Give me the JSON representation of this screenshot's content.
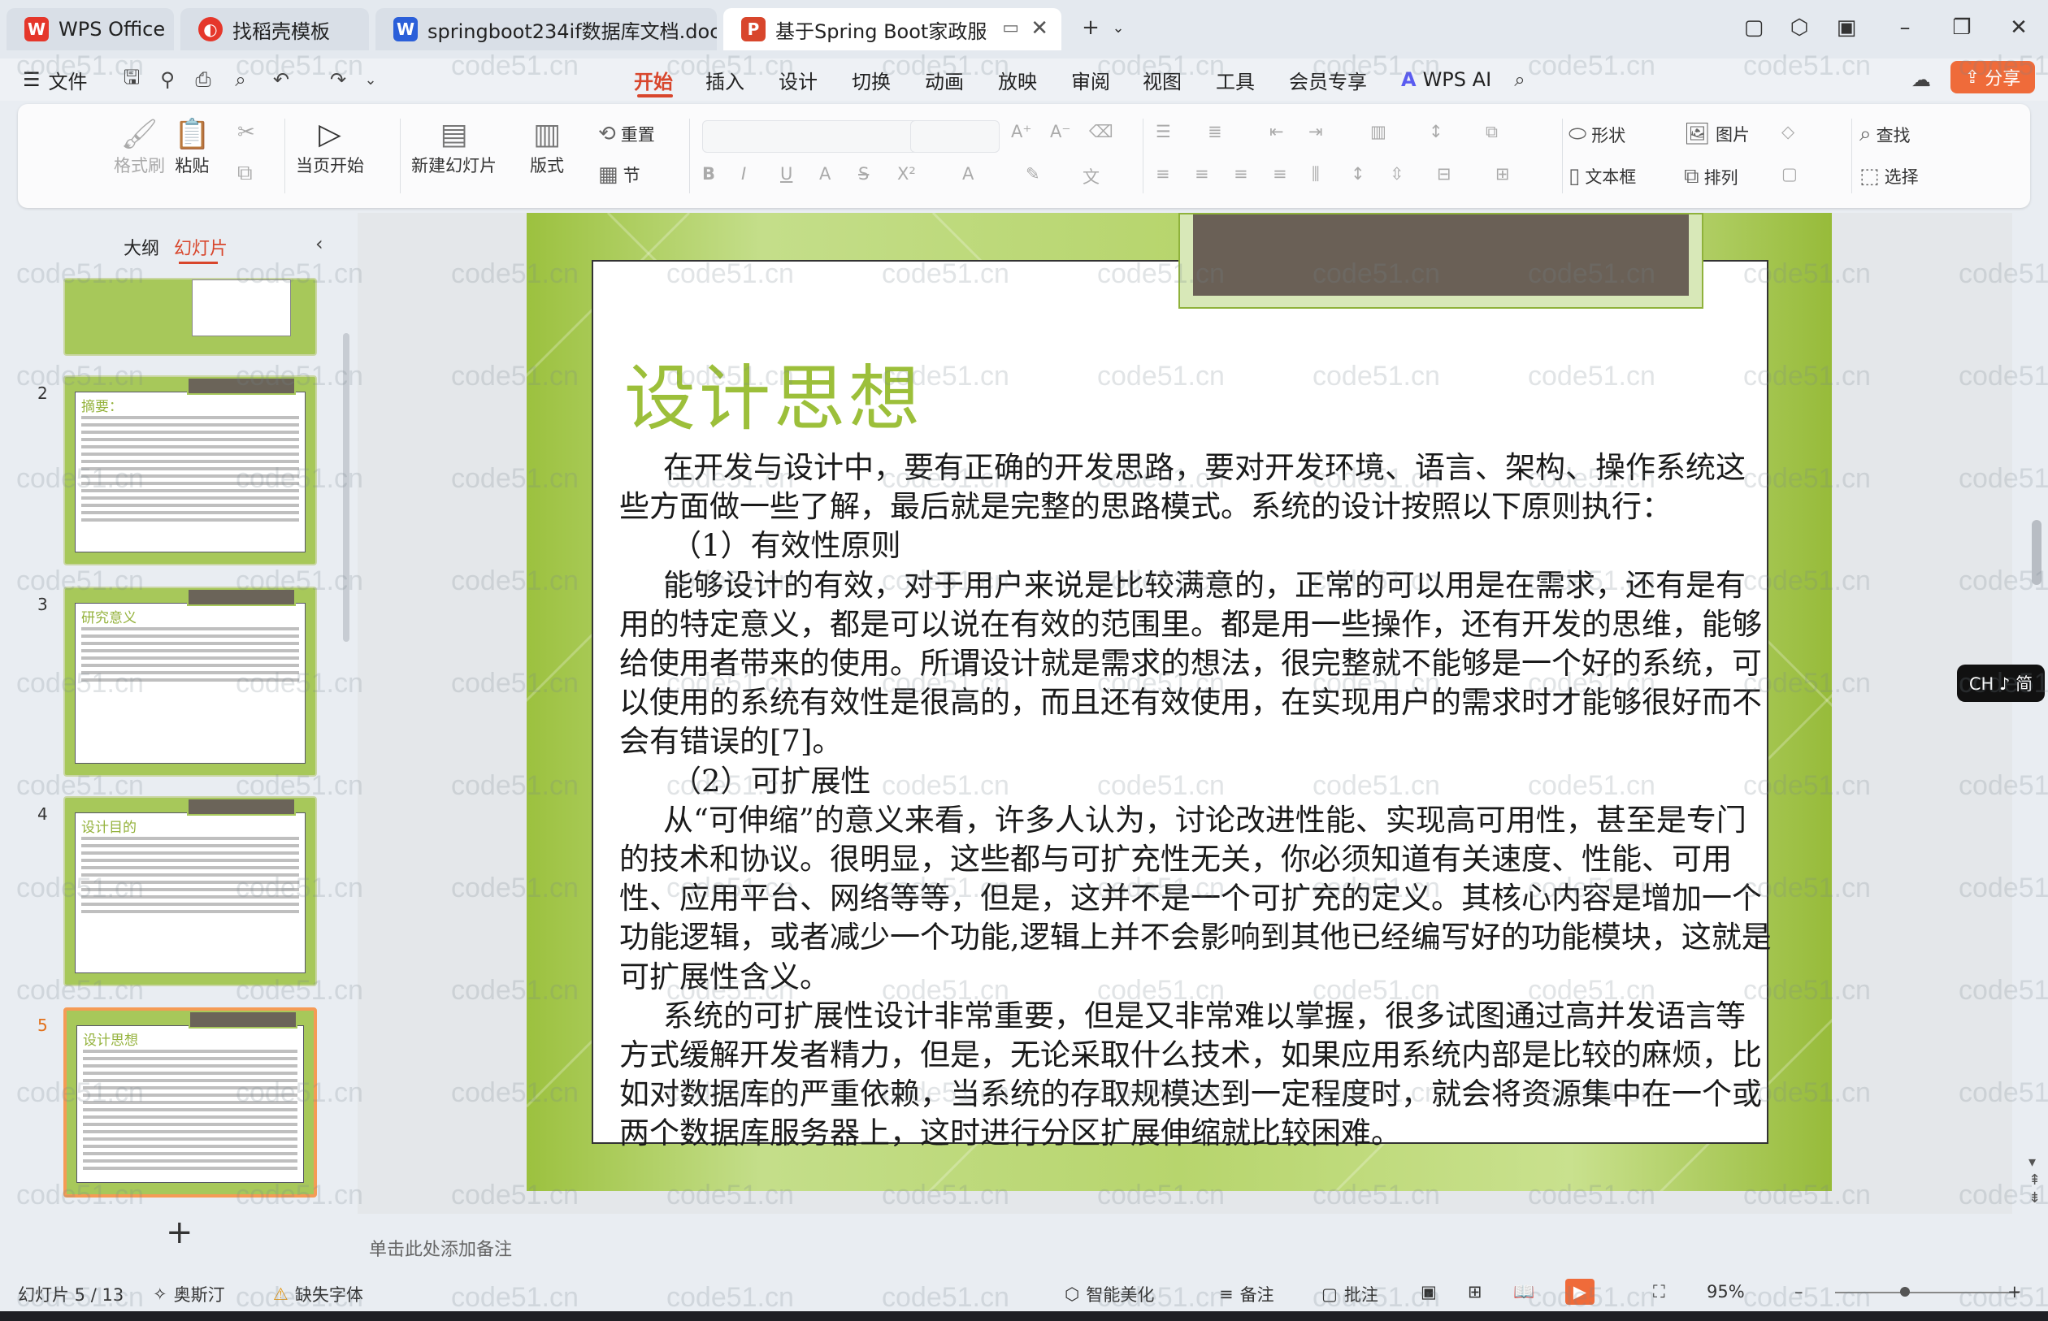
{
  "tabs": [
    {
      "label": "WPS Office",
      "icon": "wps-logo-icon",
      "color": "#e5372b"
    },
    {
      "label": "找稻壳模板",
      "icon": "docer-icon",
      "color": "#e5372b"
    },
    {
      "label": "springboot234if数据库文档.doc",
      "icon": "word-doc-icon",
      "color": "#2b5fd9"
    },
    {
      "label": "基于Spring Boot家政服务系",
      "icon": "ppt-icon",
      "color": "#d8462c"
    }
  ],
  "menu": {
    "file": "文件",
    "items": [
      "开始",
      "插入",
      "设计",
      "切换",
      "动画",
      "放映",
      "审阅",
      "视图",
      "工具",
      "会员专享"
    ],
    "active": "开始",
    "wps_ai": "WPS AI",
    "share": "分享"
  },
  "ribbon": {
    "format_painter": "格式刷",
    "paste": "粘贴",
    "play_from_current": "当页开始",
    "new_slide": "新建幻灯片",
    "layout": "版式",
    "reset": "重置",
    "section": "节",
    "shape": "形状",
    "picture": "图片",
    "textbox": "文本框",
    "arrange": "排列",
    "find": "查找",
    "select": "选择"
  },
  "left_panel": {
    "tab_outline": "大纲",
    "tab_slides": "幻灯片",
    "slides": [
      {
        "num": "2",
        "title": "摘要："
      },
      {
        "num": "3",
        "title": "研究意义"
      },
      {
        "num": "4",
        "title": "设计目的"
      },
      {
        "num": "5",
        "title": "设计思想"
      }
    ],
    "selected": "5",
    "add": "+"
  },
  "slide": {
    "title": "设计思想",
    "p1": "在开发与设计中，要有正确的开发思路，要对开发环境、语言、架构、操作系统这些方面做一些了解，最后就是完整的思路模式。系统的设计按照以下原则执行：",
    "h1": "（1）有效性原则",
    "p2": "能够设计的有效，对于用户来说是比较满意的，正常的可以用是在需求，还有是有用的特定意义，都是可以说在有效的范围里。都是用一些操作，还有开发的思维，能够给使用者带来的使用。所谓设计就是需求的想法，很完整就不能够是一个好的系统，可以使用的系统有效性是很高的，而且还有效使用，在实现用户的需求时才能够很好而不会有错误的[7]。",
    "h2": "（2）可扩展性",
    "p3": "从“可伸缩”的意义来看，许多人认为，讨论改进性能、实现高可用性，甚至是专门的技术和协议。很明显，这些都与可扩充性无关，你必须知道有关速度、性能、可用性、应用平台、网络等等，但是，这并不是一个可扩充的定义。其核心内容是增加一个功能逻辑，或者减少一个功能,逻辑上并不会影响到其他已经编写好的功能模块，这就是可扩展性含义。",
    "p4": "系统的可扩展性设计非常重要，但是又非常难以掌握，很多试图通过高并发语言等方式缓解开发者精力，但是，无论采取什么技术，如果应用系统内部是比较的麻烦，比如对数据库的严重依赖，当系统的存取规模达到一定程度时，就会将资源集中在一个或两个数据库服务器上，这时进行分区扩展伸缩就比较困难。"
  },
  "notes_placeholder": "单击此处添加备注",
  "status": {
    "slide_counter": "幻灯片 5 / 13",
    "theme": "奥斯汀",
    "missing_font": "缺失字体",
    "smart_beautify": "智能美化",
    "notes": "备注",
    "comment": "批注",
    "zoom": "95%"
  },
  "ime": "CH ♪ 简",
  "watermark": "code51.cn"
}
